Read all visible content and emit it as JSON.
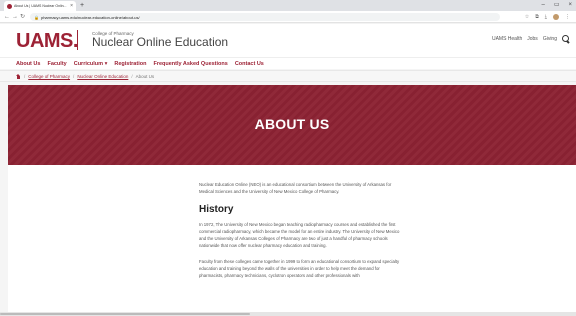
{
  "browser": {
    "tab_title": "About Us | UAMS Nuclear Onlin...",
    "tab_close": "×",
    "new_tab": "+",
    "window_controls": [
      "–",
      "▭",
      "×"
    ],
    "url": "pharmacy.uams.edu/nuclear-education-online/about-us/",
    "nav_icons": [
      "back-icon",
      "forward-icon",
      "reload-icon"
    ],
    "toolbar_icons": [
      "bookmark-star-icon",
      "extensions-icon",
      "menu-icon"
    ]
  },
  "site": {
    "logo": "UAMS.",
    "college": "College of Pharmacy",
    "department": "Nuclear Online Education",
    "utility_links": [
      "UAMS Health",
      "Jobs",
      "Giving"
    ]
  },
  "mainnav": [
    "About Us",
    "Faculty",
    "Curriculum ▾",
    "Registration",
    "Frequently Asked Questions",
    "Contact Us"
  ],
  "breadcrumb": {
    "items": [
      "College of Pharmacy",
      "Nuclear Online Education"
    ],
    "separator": "/",
    "current": "About Us"
  },
  "hero": {
    "title": "ABOUT US"
  },
  "content": {
    "intro": "Nuclear Education Online (NEO) is an educational consortium between the University of Arkansas for Medical Sciences and the University of New Mexico College of Pharmacy.",
    "history_heading": "History",
    "history_p1": "In 1972, The University of New Mexico began teaching radiopharmacy courses and established the first commercial radiopharmacy, which became the model for an entire industry. The University of New Mexico and the University of Arkansas Colleges of Pharmacy are two of just a handful of pharmacy schools nationwide that now offer nuclear pharmacy education and training.",
    "history_p2": "Faculty from these colleges came together in 1999 to form an educational consortium to expand specialty education and training beyond the walls of the universities in order to help meet the demand for pharmacists, pharmacy technicians, cyclotron operators and other professionals with"
  },
  "colors": {
    "brand": "#9d2235",
    "hero_bg": "#8c2233"
  }
}
